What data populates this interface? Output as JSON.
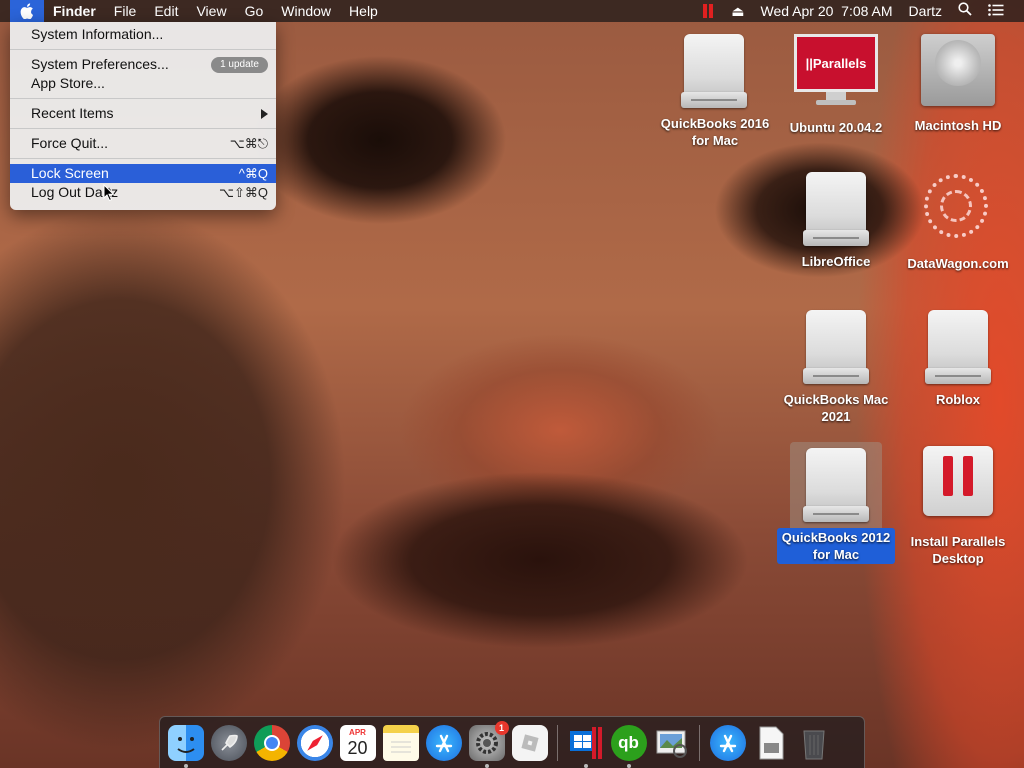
{
  "menubar": {
    "apple_glyph": "",
    "app_name": "Finder",
    "items": [
      "File",
      "Edit",
      "View",
      "Go",
      "Window",
      "Help"
    ],
    "eject_glyph": "⏏",
    "datetime": "Wed Apr 20  7:08 AM",
    "user": "Dartz",
    "search_glyph": "⌕",
    "list_glyph": "☰"
  },
  "apple_menu": {
    "system_information": "System Information...",
    "system_preferences": "System Preferences...",
    "update_badge": "1 update",
    "app_store": "App Store...",
    "recent_items": "Recent Items",
    "force_quit": "Force Quit...",
    "force_quit_shortcut": "⌥⌘⎋",
    "lock_screen": "Lock Screen",
    "lock_screen_shortcut": "^⌘Q",
    "log_out": "Log Out Dartz",
    "log_out_shortcut": "⌥⇧⌘Q"
  },
  "desktop_icons": {
    "qb2016": "QuickBooks 2016 for Mac",
    "ubuntu": "Ubuntu 20.04.2",
    "ubuntu_screen_text": "||Parallels",
    "macintosh_hd": "Macintosh HD",
    "libreoffice": "LibreOffice",
    "datawagon": "DataWagon.com",
    "qb2021": "QuickBooks Mac 2021",
    "roblox": "Roblox",
    "qb2012": "QuickBooks 2012 for Mac",
    "install_parallels": "Install Parallels Desktop"
  },
  "dock": {
    "calendar_month": "APR",
    "calendar_day": "20",
    "settings_badge": "1",
    "quickbooks_text": "qb"
  },
  "colors": {
    "menu_highlight": "#2a5fd8",
    "selection": "#1f5fd8",
    "parallels_red": "#d41a2a"
  }
}
